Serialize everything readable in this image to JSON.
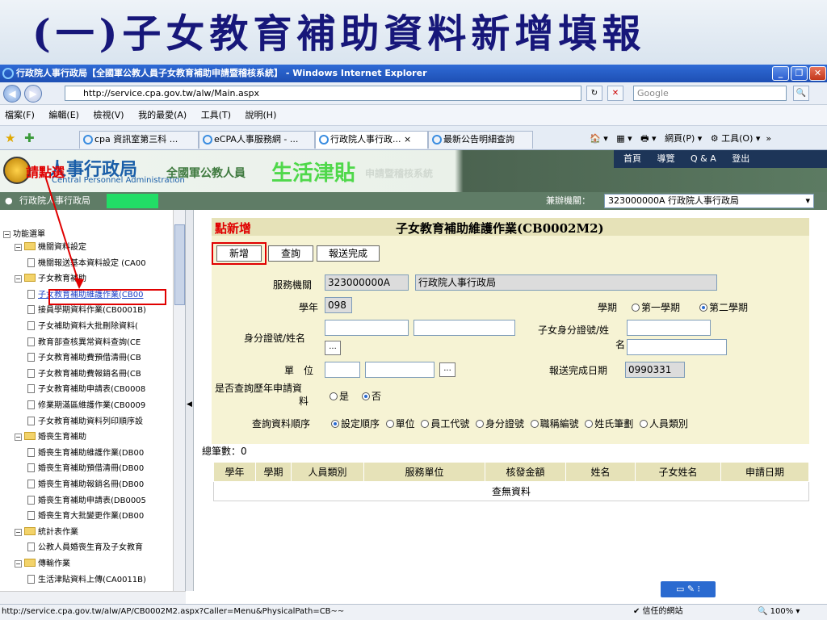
{
  "slide": {
    "title": "(一)子女教育補助資料新增填報"
  },
  "window": {
    "title": "行政院人事行政局【全國軍公教人員子女教育補助申請暨稽核系統】 - Windows Internet Explorer",
    "min": "_",
    "max": "❐",
    "close": "✕"
  },
  "address": {
    "url": "http://service.cpa.gov.tw/alw/Main.aspx",
    "search_placeholder": "Google",
    "back": "◀",
    "forward": "▶",
    "refresh": "↻",
    "stop": "✕",
    "search_go": "🔍"
  },
  "menu": {
    "items": [
      "檔案(F)",
      "編輯(E)",
      "檢視(V)",
      "我的最愛(A)",
      "工具(T)",
      "說明(H)"
    ]
  },
  "tabs": [
    {
      "label": "cpa 資訊室第三科 ..."
    },
    {
      "label": "eCPA人事服務網 - ..."
    },
    {
      "label": "行政院人事行政... ×"
    },
    {
      "label": "最新公告明細查詢"
    }
  ],
  "toolbar_right": {
    "home": "🏠 ▾",
    "feeds": "▦ ▾",
    "print": "🖶 ▾",
    "page": "網頁(P) ▾",
    "tools": "⚙ 工具(O) ▾",
    "more": "»"
  },
  "header": {
    "agency": "人事行政局",
    "agency_en": "Central Personnel Administration",
    "system1": "全國軍公教人員",
    "system2": "生活津貼",
    "system3": "申請暨稽核系統",
    "nav": [
      "首頁",
      "導覽",
      "Q & A",
      "登出"
    ],
    "click_note": "請點選"
  },
  "subheader": {
    "user": "行政院人事行政局",
    "unit_label": "兼辦機關：",
    "unit_value": "323000000A 行政院人事行政局"
  },
  "sidebar": {
    "root": "功能選單",
    "items": [
      {
        "label": "機關資料設定",
        "type": "folder"
      },
      {
        "label": "機關報送基本資料設定 (CA00",
        "type": "doc"
      },
      {
        "label": "子女教育補助",
        "type": "folder"
      },
      {
        "label": "子女教育補助維護作業(CB00",
        "type": "doc"
      },
      {
        "label": "接員學期資料作業(CB0001B)",
        "type": "doc"
      },
      {
        "label": "子女補助資料大批刪除資料(",
        "type": "doc"
      },
      {
        "label": "教育部查核異常資料查詢(CE",
        "type": "doc"
      },
      {
        "label": "子女教育補助費預借清冊(CB",
        "type": "doc"
      },
      {
        "label": "子女教育補助費報銷名冊(CB",
        "type": "doc"
      },
      {
        "label": "子女教育補助申請表(CB0008",
        "type": "doc"
      },
      {
        "label": "修業期滿區維護作業(CB0009",
        "type": "doc"
      },
      {
        "label": "子女教育補助資料列印順序設",
        "type": "doc"
      },
      {
        "label": "婚喪生育補助",
        "type": "folder"
      },
      {
        "label": "婚喪生育補助維護作業(DB00",
        "type": "doc"
      },
      {
        "label": "婚喪生育補助預借清冊(DB00",
        "type": "doc"
      },
      {
        "label": "婚喪生育補助報銷名冊(DB00",
        "type": "doc"
      },
      {
        "label": "婚喪生育補助申請表(DB0005",
        "type": "doc"
      },
      {
        "label": "婚喪生育大批變更作業(DB00",
        "type": "doc"
      },
      {
        "label": "統計表作業",
        "type": "folder"
      },
      {
        "label": "公教人員婚喪生育及子女教育",
        "type": "doc"
      },
      {
        "label": "傳輸作業",
        "type": "folder"
      },
      {
        "label": "生活津貼資料上傳(CA0011B)",
        "type": "doc"
      }
    ]
  },
  "form": {
    "add_note": "點新增",
    "title": "子女教育補助維護作業(CB0002M2)",
    "buttons": {
      "add": "新增",
      "query": "查詢",
      "submit": "報送完成"
    },
    "service_unit_label": "服務機關",
    "service_unit_code": "323000000A",
    "service_unit_name": "行政院人事行政局",
    "year_label": "學年",
    "year_value": "098",
    "term_label": "學期",
    "term_options": [
      "第一學期",
      "第二學期"
    ],
    "term_selected": 1,
    "id_name_label": "身分證號/姓名",
    "child_id_label_1": "子女身分證號/姓",
    "child_id_label_2": "名",
    "unit_label": "單　位",
    "report_date_label": "報送完成日期",
    "report_date_value": "0990331",
    "history_label_1": "是否查詢歷年申請資",
    "history_label_2": "料",
    "history_options": [
      "是",
      "否"
    ],
    "history_selected": 1,
    "order_label": "查詢資料順序",
    "order_options": [
      "設定順序",
      "單位",
      "員工代號",
      "身分證號",
      "職稱編號",
      "姓氏筆劃",
      "人員類別"
    ],
    "order_selected": 0,
    "browse": "...",
    "total_label": "總筆數：",
    "total_value": "0"
  },
  "table": {
    "headers": [
      "學年",
      "學期",
      "人員類別",
      "服務單位",
      "核發金額",
      "姓名",
      "子女姓名",
      "申請日期"
    ],
    "empty": "查無資料"
  },
  "widget": {
    "label": "▭ ✎ ⁝"
  },
  "status": {
    "url": "http://service.cpa.gov.tw/alw/AP/CB0002M2.aspx?Caller=Menu&PhysicalPath=CB~~",
    "zone": "✔ 信任的網站",
    "zoom": "🔍 100% ▾"
  },
  "colors": {
    "accent_red": "#e00000",
    "panel_bg": "#f6f3d4",
    "header_green": "#5f7c66",
    "title_blue": "#17177a"
  }
}
